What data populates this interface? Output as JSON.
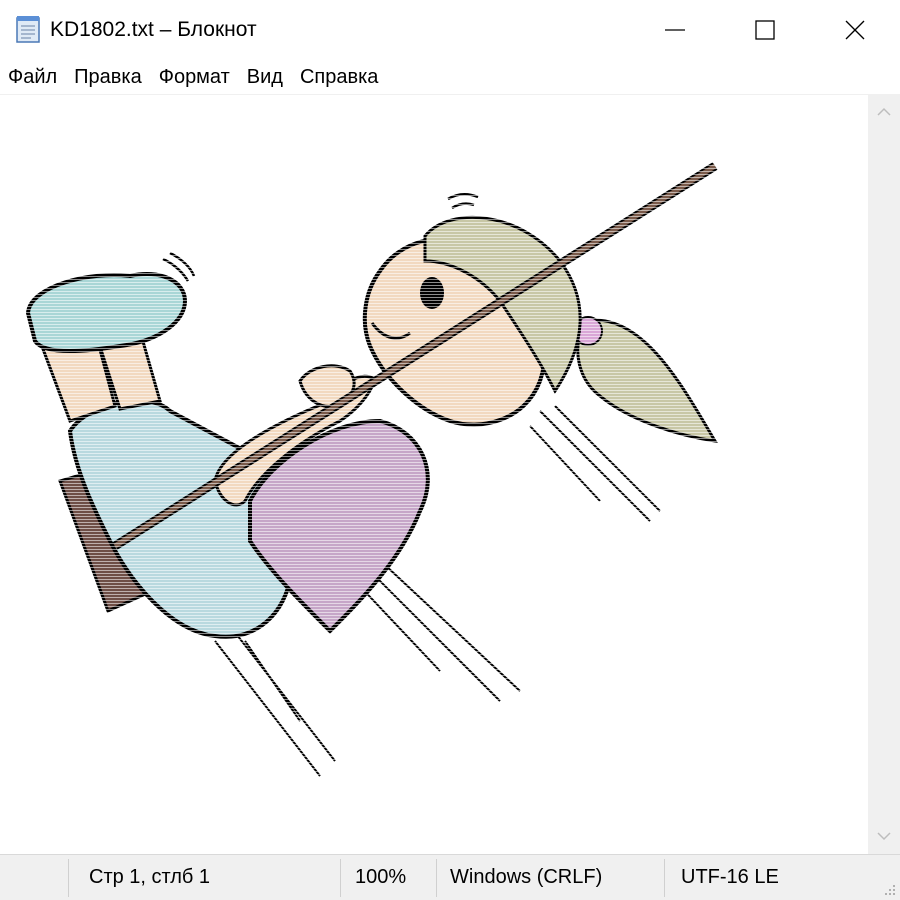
{
  "window": {
    "title": "KD1802.txt – Блокнот",
    "icon": "notepad-icon",
    "controls": [
      "minimize-icon",
      "maximize-icon",
      "close-icon"
    ]
  },
  "menu": {
    "items": [
      "Файл",
      "Правка",
      "Формат",
      "Вид",
      "Справка"
    ]
  },
  "editor": {
    "content_description": "ascii-art-girl-on-rope-swing",
    "colors": {
      "skin": "#f2d9c0",
      "hair": "#c8c7a6",
      "shirt": "#c6a6c8",
      "pants": "#b9d9df",
      "shoes": "#a9d6d6",
      "seat": "#6e4e46",
      "rope": "#7a5a4a",
      "bow": "#d9a6d6",
      "outline": "#000000"
    }
  },
  "statusbar": {
    "position": "Стр 1, стлб 1",
    "zoom": "100%",
    "line_endings": "Windows (CRLF)",
    "encoding": "UTF-16 LE"
  },
  "scrollbar": {
    "up_icon": "chevron-up-icon",
    "down_icon": "chevron-down-icon"
  }
}
